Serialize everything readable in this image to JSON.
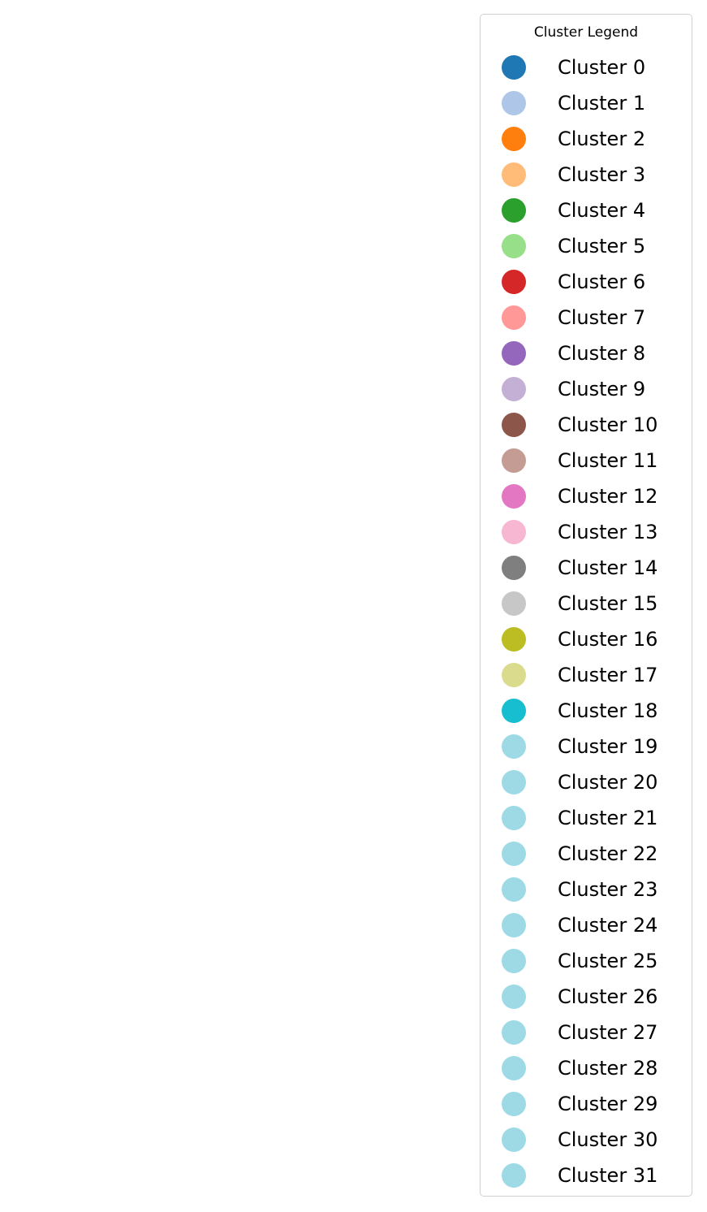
{
  "chart_data": {
    "type": "scatter",
    "title": "",
    "legend": {
      "title": "Cluster Legend",
      "placement": "right",
      "entries": [
        {
          "label": "Cluster 0",
          "color": "#1f77b4"
        },
        {
          "label": "Cluster 1",
          "color": "#aec7e8"
        },
        {
          "label": "Cluster 2",
          "color": "#ff7f0e"
        },
        {
          "label": "Cluster 3",
          "color": "#ffbb78"
        },
        {
          "label": "Cluster 4",
          "color": "#2ca02c"
        },
        {
          "label": "Cluster 5",
          "color": "#98df8a"
        },
        {
          "label": "Cluster 6",
          "color": "#d62728"
        },
        {
          "label": "Cluster 7",
          "color": "#ff9896"
        },
        {
          "label": "Cluster 8",
          "color": "#9467bd"
        },
        {
          "label": "Cluster 9",
          "color": "#c5b0d5"
        },
        {
          "label": "Cluster 10",
          "color": "#8c564b"
        },
        {
          "label": "Cluster 11",
          "color": "#c49c94"
        },
        {
          "label": "Cluster 12",
          "color": "#e377c2"
        },
        {
          "label": "Cluster 13",
          "color": "#f7b6d2"
        },
        {
          "label": "Cluster 14",
          "color": "#7f7f7f"
        },
        {
          "label": "Cluster 15",
          "color": "#c7c7c7"
        },
        {
          "label": "Cluster 16",
          "color": "#bcbd22"
        },
        {
          "label": "Cluster 17",
          "color": "#dbdb8d"
        },
        {
          "label": "Cluster 18",
          "color": "#17becf"
        },
        {
          "label": "Cluster 19",
          "color": "#9edae5"
        },
        {
          "label": "Cluster 20",
          "color": "#9edae5"
        },
        {
          "label": "Cluster 21",
          "color": "#9edae5"
        },
        {
          "label": "Cluster 22",
          "color": "#9edae5"
        },
        {
          "label": "Cluster 23",
          "color": "#9edae5"
        },
        {
          "label": "Cluster 24",
          "color": "#9edae5"
        },
        {
          "label": "Cluster 25",
          "color": "#9edae5"
        },
        {
          "label": "Cluster 26",
          "color": "#9edae5"
        },
        {
          "label": "Cluster 27",
          "color": "#9edae5"
        },
        {
          "label": "Cluster 28",
          "color": "#9edae5"
        },
        {
          "label": "Cluster 29",
          "color": "#9edae5"
        },
        {
          "label": "Cluster 30",
          "color": "#9edae5"
        },
        {
          "label": "Cluster 31",
          "color": "#9edae5"
        }
      ]
    },
    "series": [],
    "grid": false
  }
}
